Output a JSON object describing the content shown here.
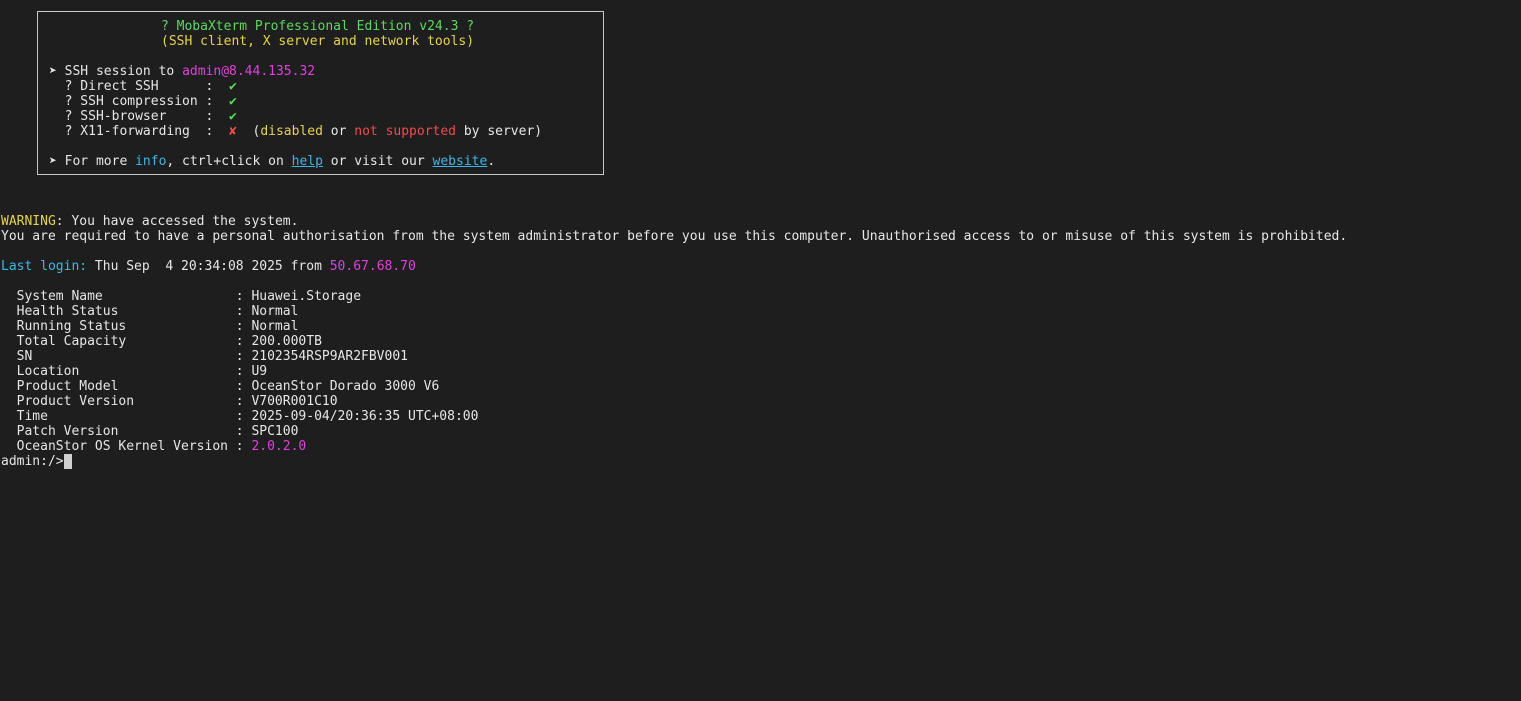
{
  "colors": {
    "background": "#1e1e1e",
    "text": "#e6e6e6",
    "green": "#5fd75f",
    "magenta": "#e040e0",
    "yellow": "#e6d34a",
    "red": "#f04b4b",
    "cyan": "#3fb6e8"
  },
  "banner": {
    "title": "? MobaXterm Professional Edition v24.3 ?",
    "subtitle": "(SSH client, X server and network tools)",
    "session_prefix": "➤ SSH session to ",
    "session_target": "admin@8.44.135.32",
    "features": [
      {
        "label": "  ? Direct SSH      :  ",
        "mark": "✔",
        "status": "ok"
      },
      {
        "label": "  ? SSH compression :  ",
        "mark": "✔",
        "status": "ok"
      },
      {
        "label": "  ? SSH-browser     :  ",
        "mark": "✔",
        "status": "ok"
      },
      {
        "label": "  ? X11-forwarding  :  ",
        "mark": "✘",
        "status": "fail"
      }
    ],
    "x11_note_open": "  (",
    "x11_disabled": "disabled",
    "x11_or": " or ",
    "x11_not_supported": "not supported",
    "x11_by_server": " by server)",
    "more_prefix": "➤ For more ",
    "more_info": "info",
    "more_mid": ", ctrl+click on ",
    "more_help": "help",
    "more_visit": " or visit our ",
    "more_website": "website",
    "more_end": "."
  },
  "warning": {
    "label": "WARNING",
    "text": ": You have accessed the system.",
    "line2": "You are required to have a personal authorisation from the system administrator before you use this computer. Unauthorised access to or misuse of this system is prohibited."
  },
  "last_login": {
    "label": "Last login:",
    "date": " Thu Sep  4 20:34:08 2025 from ",
    "ip": "50.67.68.70"
  },
  "system_info": [
    {
      "key": "  System Name                 : ",
      "value": "Huawei.Storage"
    },
    {
      "key": "  Health Status               : ",
      "value": "Normal"
    },
    {
      "key": "  Running Status              : ",
      "value": "Normal"
    },
    {
      "key": "  Total Capacity              : ",
      "value": "200.000TB"
    },
    {
      "key": "  SN                          : ",
      "value": "2102354RSP9AR2FBV001"
    },
    {
      "key": "  Location                    : ",
      "value": "U9"
    },
    {
      "key": "  Product Model               : ",
      "value": "OceanStor Dorado 3000 V6"
    },
    {
      "key": "  Product Version             : ",
      "value": "V700R001C10"
    },
    {
      "key": "  Time                        : ",
      "value": "2025-09-04/20:36:35 UTC+08:00"
    },
    {
      "key": "  Patch Version               : ",
      "value": "SPC100"
    },
    {
      "key": "  OceanStor OS Kernel Version : ",
      "value": "2.0.2.0"
    }
  ],
  "prompt": "admin:/>"
}
